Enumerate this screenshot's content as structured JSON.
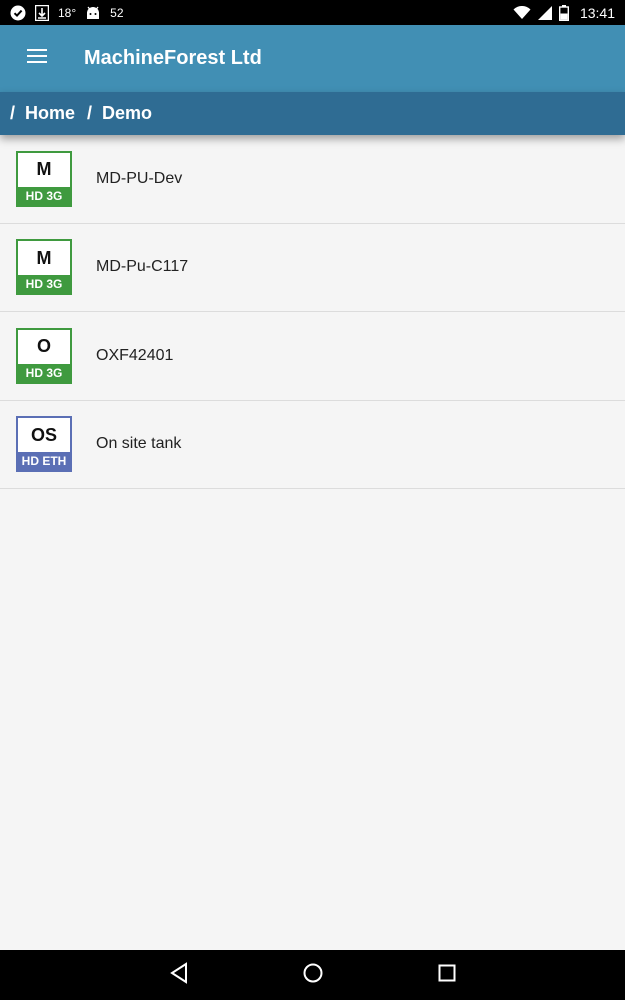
{
  "status_bar": {
    "temperature": "18°",
    "battery_percent": "52",
    "time": "13:41",
    "icons": [
      "check-circle-icon",
      "download-icon",
      "android-icon",
      "wifi-icon",
      "signal-icon",
      "battery-icon"
    ]
  },
  "app_bar": {
    "title": "MachineForest Ltd",
    "menu_icon": "hamburger-menu-icon"
  },
  "breadcrumb": {
    "separator": "/",
    "items": [
      "Home",
      "Demo"
    ]
  },
  "devices": [
    {
      "badge_letter": "M",
      "badge_type": "HD 3G",
      "name": "MD-PU-Dev",
      "badge_color": "#3f9a3f"
    },
    {
      "badge_letter": "M",
      "badge_type": "HD 3G",
      "name": "MD-Pu-C117",
      "badge_color": "#3f9a3f"
    },
    {
      "badge_letter": "O",
      "badge_type": "HD 3G",
      "name": "OXF42401",
      "badge_color": "#3f9a3f"
    },
    {
      "badge_letter": "OS",
      "badge_type": "HD ETH",
      "name": "On site tank",
      "badge_color": "#5b6fb5"
    }
  ],
  "nav_bar": {
    "icons": [
      "back-icon",
      "home-icon",
      "recents-icon"
    ]
  },
  "colors": {
    "app_bar": "#418fb4",
    "breadcrumb_bar": "#2f6c93",
    "badge_green": "#3f9a3f",
    "badge_blue": "#5b6fb5"
  }
}
